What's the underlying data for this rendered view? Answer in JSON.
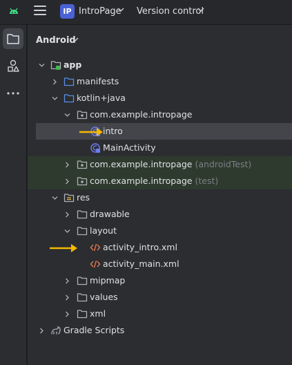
{
  "topbar": {
    "project_badge": "IP",
    "project_name": "IntroPage",
    "version_control": "Version control"
  },
  "panel": {
    "title": "Android"
  },
  "tree": [
    {
      "label": "app",
      "bold": true
    },
    {
      "label": "manifests"
    },
    {
      "label": "kotlin+java"
    },
    {
      "label": "com.example.intropage"
    },
    {
      "label": "intro",
      "selected": true
    },
    {
      "label": "MainActivity"
    },
    {
      "label": "com.example.intropage",
      "suffix": "(androidTest)"
    },
    {
      "label": "com.example.intropage",
      "suffix": "(test)"
    },
    {
      "label": "res"
    },
    {
      "label": "drawable"
    },
    {
      "label": "layout"
    },
    {
      "label": "activity_intro.xml"
    },
    {
      "label": "activity_main.xml"
    },
    {
      "label": "mipmap"
    },
    {
      "label": "values"
    },
    {
      "label": "xml"
    },
    {
      "label": "Gradle Scripts"
    }
  ],
  "colors": {
    "background": "#2b2d30",
    "selection": "#43454a",
    "test_highlight": "#2e3a2e",
    "folder_icon": "#5a8ee6",
    "class_icon": "#6e7cf0",
    "xml_icon": "#e0784a",
    "annotation_arrow": "#f5b800"
  },
  "icons": {
    "app_module": "android-module-icon",
    "folder": "folder-icon",
    "package": "package-icon",
    "class": "kotlin-class-icon",
    "xml": "xml-file-icon",
    "res": "resources-folder-icon",
    "gradle": "gradle-icon"
  }
}
